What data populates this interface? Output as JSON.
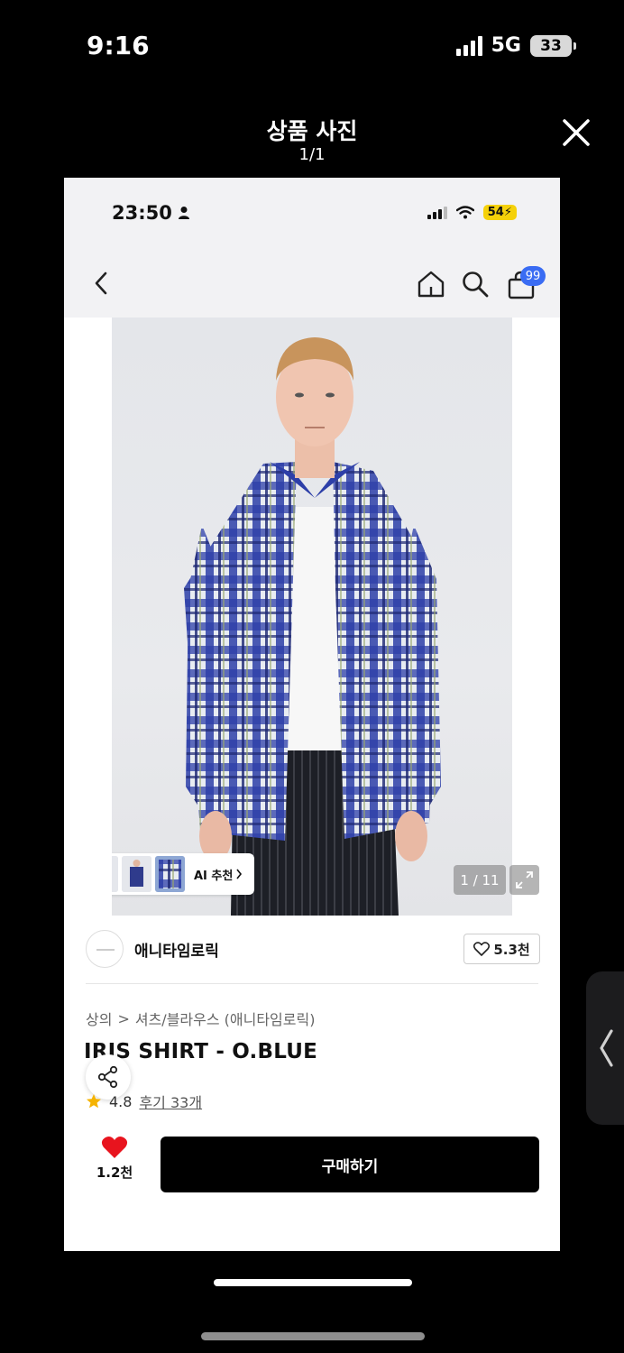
{
  "os_status": {
    "time": "9:16",
    "network": "5G",
    "battery": "33"
  },
  "viewer": {
    "title": "상품 사진",
    "counter": "1/1"
  },
  "inner_status": {
    "time": "23:50",
    "battery": "54"
  },
  "inner_nav": {
    "cart_badge": "99"
  },
  "product_image": {
    "ai_recommend_label": "AI 추천",
    "image_counter": "1 / 11"
  },
  "brand": {
    "name": "애니타임로릭",
    "like_count": "5.3천"
  },
  "breadcrumb": {
    "category": "상의",
    "separator": ">",
    "subcategory": "셔츠/블라우스 (애니타임로릭)"
  },
  "product": {
    "title": "IRIS SHIRT - O.BLUE",
    "rating": "4.8",
    "review_link": "후기 33개"
  },
  "bottom_bar": {
    "wish_count": "1.2천",
    "buy_label": "구매하기"
  },
  "colors": {
    "accent_blue": "#3a6cf3",
    "heart_red": "#e8141e",
    "star_yellow": "#f5b301",
    "buy_button": "#000000"
  }
}
